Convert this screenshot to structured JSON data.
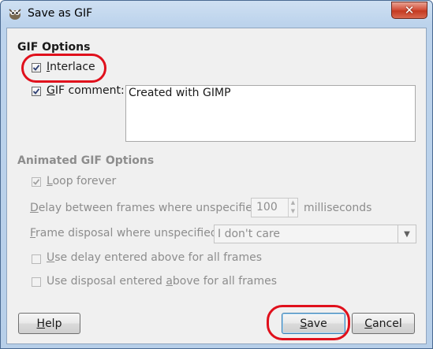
{
  "window": {
    "title": "Save as GIF",
    "icon": "gimp-wilber-icon",
    "close_label": "✕"
  },
  "gif_options": {
    "heading": "GIF Options",
    "interlace": {
      "accel": "I",
      "rest": "nterlace",
      "checked": true
    },
    "gif_comment": {
      "accel": "G",
      "rest": "IF comment:",
      "checked": true
    },
    "comment_text": "Created with GIMP"
  },
  "animated_options": {
    "heading": "Animated GIF Options",
    "loop_forever": {
      "accel": "L",
      "rest": "oop forever",
      "checked": true,
      "enabled": false
    },
    "delay": {
      "label_accel": "D",
      "label_rest": "elay between frames where unspecified:",
      "value": "100",
      "unit": "milliseconds"
    },
    "disposal": {
      "label_accel": "F",
      "label_rest": "rame disposal where unspecified:",
      "value": "I don't care"
    },
    "use_delay": {
      "accel": "U",
      "rest": "se delay entered above for all frames",
      "checked": false
    },
    "use_disposal": {
      "pre": "Use disposal entered ",
      "accel": "a",
      "rest": "bove for all frames",
      "checked": false
    }
  },
  "buttons": {
    "help": {
      "accel": "H",
      "rest": "elp"
    },
    "save": {
      "accel": "S",
      "rest": "ave"
    },
    "cancel": {
      "accel": "C",
      "rest": "ancel"
    }
  },
  "colors": {
    "annotation_ring": "#e0101c",
    "title_bar": "#bcd3ec",
    "close_button": "#c43a21"
  }
}
